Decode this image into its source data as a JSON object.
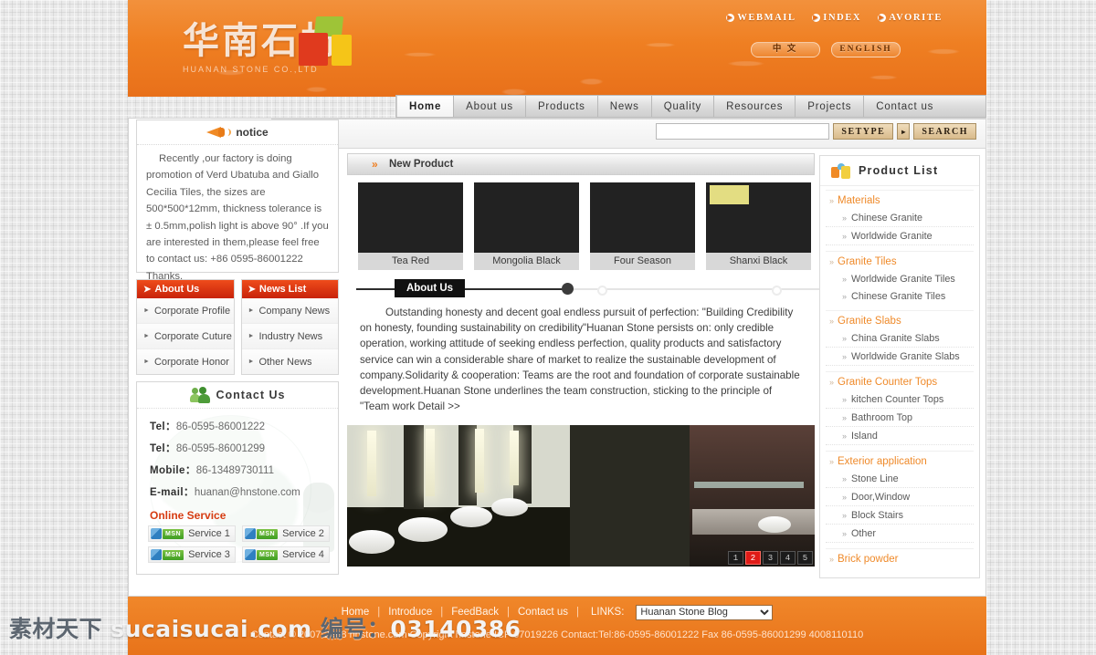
{
  "colors": {
    "brand_orange": "#ef7f22",
    "brand_orange_dark": "#e8701a",
    "accent_red": "#c8230a",
    "pager_active": "#e01b17",
    "category_orange": "#ef8a2a",
    "online_service_red": "#d63c12"
  },
  "header": {
    "logo_cn": "华南石材",
    "logo_sub": "HUANAN STONE  CO.,LTD",
    "top_links": [
      {
        "label": "WEBMAIL",
        "bullet": "play-bullet-icon"
      },
      {
        "label": "INDEX",
        "bullet": "play-bullet-icon"
      },
      {
        "label": "AVORITE",
        "bullet": "play-bullet-icon"
      }
    ],
    "lang_buttons": [
      {
        "label": "中 文"
      },
      {
        "label": "ENGLISH"
      }
    ]
  },
  "nav": {
    "items": [
      {
        "label": "Home",
        "active": true
      },
      {
        "label": "About us",
        "active": false
      },
      {
        "label": "Products",
        "active": false
      },
      {
        "label": "News",
        "active": false
      },
      {
        "label": "Quality",
        "active": false
      },
      {
        "label": "Resources",
        "active": false
      },
      {
        "label": "Projects",
        "active": false
      },
      {
        "label": "Contact us",
        "active": false
      }
    ]
  },
  "search": {
    "value": "",
    "placeholder": "",
    "setype_label": "SETYPE",
    "arrow_label": "▸",
    "search_label": "SEARCH"
  },
  "notice": {
    "icon": "megaphone-icon",
    "title": "notice",
    "body": "Recently ,our factory is doing promotion of Verd Ubatuba and Giallo Cecilia Tiles, the sizes are 500*500*12mm, thickness tolerance is ± 0.5mm,polish light is above 90° .If you are interested in them,please feel free to contact us: +86 0595-86001222 Thanks."
  },
  "about_menu": {
    "title": "About Us",
    "items": [
      {
        "label": "Corporate Profile"
      },
      {
        "label": "Corporate Cuture"
      },
      {
        "label": "Corporate Honor"
      }
    ]
  },
  "news_menu": {
    "title": "News List",
    "items": [
      {
        "label": "Company News"
      },
      {
        "label": "Industry News"
      },
      {
        "label": "Other News"
      }
    ]
  },
  "contact": {
    "icon": "people-icon",
    "title": "Contact Us",
    "rows": [
      {
        "label": "Tel：",
        "value": "86-0595-86001222"
      },
      {
        "label": "Tel：",
        "value": "86-0595-86001299"
      },
      {
        "label": "Mobile：",
        "value": "86-13489730111"
      },
      {
        "label": "E-mail：",
        "value": "huanan@hnstone.com"
      }
    ],
    "online_title": "Online Service",
    "services": [
      {
        "label": "Service 1",
        "badge": "msn"
      },
      {
        "label": "Service 2",
        "badge": "msn"
      },
      {
        "label": "Service 3",
        "badge": "msn"
      },
      {
        "label": "Service 4",
        "badge": "msn"
      }
    ]
  },
  "new_product": {
    "title": "New Product",
    "items": [
      {
        "name": "Tea Red"
      },
      {
        "name": "Mongolia Black"
      },
      {
        "name": "Four Season"
      },
      {
        "name": "Shanxi Black"
      }
    ]
  },
  "about_section": {
    "tab_label": "About Us",
    "body": "Outstanding honesty and decent goal endless pursuit of perfection: \"Building Credibility on honesty, founding sustainability on credibility\"Huanan Stone persists on: only credible operation, working attitude of seeking endless perfection, quality products and satisfactory service can win a considerable share of market to realize the sustainable development of company.Solidarity & cooperation: Teams are the root and foundation of corporate sustainable development.Huanan Stone underlines the team construction, sticking to the principle of \"Team work",
    "detail_label": "Detail >>"
  },
  "slideshow": {
    "pages": [
      {
        "label": "1",
        "active": false
      },
      {
        "label": "2",
        "active": true
      },
      {
        "label": "3",
        "active": false
      },
      {
        "label": "4",
        "active": false
      },
      {
        "label": "5",
        "active": false
      }
    ]
  },
  "product_list": {
    "icon": "boxes-icon",
    "title": "Product List",
    "groups": [
      {
        "category": "Materials",
        "items": [
          {
            "label": "Chinese Granite"
          },
          {
            "label": "Worldwide Granite"
          }
        ]
      },
      {
        "category": "Granite Tiles",
        "items": [
          {
            "label": "Worldwide Granite Tiles"
          },
          {
            "label": "Chinese Granite Tiles"
          }
        ]
      },
      {
        "category": "Granite Slabs",
        "items": [
          {
            "label": "China Granite Slabs"
          },
          {
            "label": "Worldwide Granite Slabs"
          }
        ]
      },
      {
        "category": "Granite Counter Tops",
        "items": [
          {
            "label": "kitchen Counter Tops"
          },
          {
            "label": "Bathroom Top"
          },
          {
            "label": "Island"
          }
        ]
      },
      {
        "category": "Exterior application",
        "items": [
          {
            "label": "Stone Line"
          },
          {
            "label": "Door,Window"
          },
          {
            "label": "Block Stairs"
          },
          {
            "label": "Other"
          }
        ]
      },
      {
        "category": "Brick powder",
        "items": []
      }
    ]
  },
  "footer": {
    "links": [
      {
        "label": "Home"
      },
      {
        "label": "Introduce"
      },
      {
        "label": "FeedBack"
      },
      {
        "label": "Contact us"
      }
    ],
    "links_label": "LINKS:",
    "select_value": "Huanan Stone Blog",
    "select_options": [
      "Huanan Stone Blog"
    ],
    "copyright": "Contact © 2007-2008 hnstone.com   Copyright hnstone  ICP  07019226  Contact:Tel:86-0595-86001222 Fax 86-0595-86001299  4008110110"
  },
  "watermark": {
    "site_cn": "素材天下",
    "site_domain": "sucaisucai.com",
    "id_label": "编号：",
    "id_value": "03140386"
  }
}
